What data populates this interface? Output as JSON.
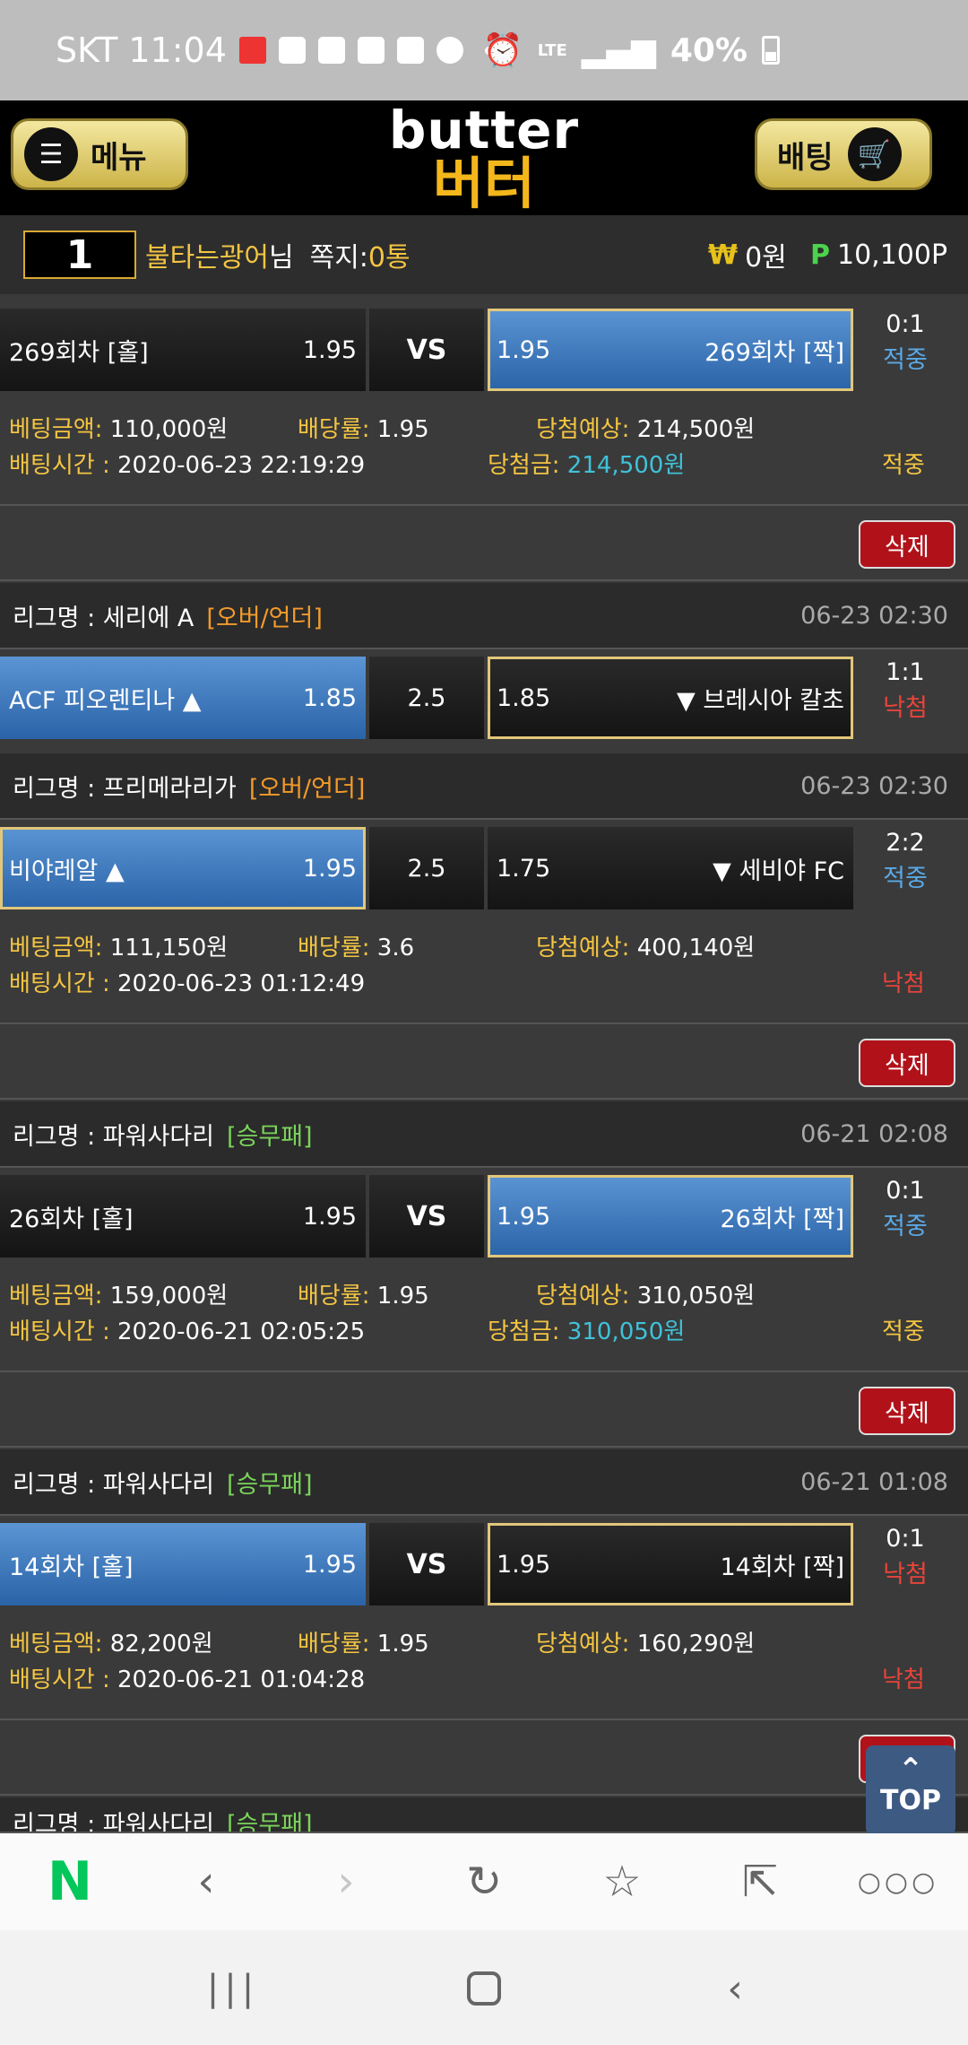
{
  "status_bar": {
    "carrier_time": "SKT 11:04",
    "battery": "40%",
    "lte": "LTE"
  },
  "header": {
    "menu_label": "메뉴",
    "bet_label": "배팅",
    "logo_en": "butter",
    "logo_ko": "버터"
  },
  "user": {
    "rank": "1",
    "name": "불타는광어",
    "suffix": "님",
    "msg_label": "쪽지:",
    "msg_count": "0통",
    "won_symbol": "₩",
    "won": "0원",
    "point_symbol": "P",
    "points": "10,100P"
  },
  "bets": [
    {
      "home_team": "269회차 [홀]",
      "home_odds": "1.95",
      "middle": "VS",
      "away_odds": "1.95",
      "away_team": "269회차 [짝]",
      "score": "0:1",
      "outcome": "적중",
      "amount_label": "베팅금액:",
      "amount": "110,000원",
      "rate_label": "배당률:",
      "rate": "1.95",
      "expected_label": "당첨예상:",
      "expected": "214,500원",
      "time_label": "배팅시간 :",
      "time": "2020-06-23 22:19:29",
      "win_label": "당첨금:",
      "win": "214,500원",
      "status": "적중",
      "delete": "삭제"
    },
    {
      "league_label": "리그명 :",
      "league": "세리에 A",
      "type": "[오버/언더]",
      "date": "06-23 02:30",
      "home_team": "ACF 피오렌티나 ▲",
      "home_odds": "1.85",
      "middle": "2.5",
      "away_odds": "1.85",
      "away_team": "▼ 브레시아 칼초",
      "score": "1:1",
      "outcome": "낙첨"
    },
    {
      "league_label": "리그명 :",
      "league": "프리메라리가",
      "type": "[오버/언더]",
      "date": "06-23 02:30",
      "home_team": "비야레알 ▲",
      "home_odds": "1.95",
      "middle": "2.5",
      "away_odds": "1.75",
      "away_team": "▼ 세비야 FC",
      "score": "2:2",
      "outcome": "적중",
      "amount_label": "베팅금액:",
      "amount": "111,150원",
      "rate_label": "배당률:",
      "rate": "3.6",
      "expected_label": "당첨예상:",
      "expected": "400,140원",
      "time_label": "배팅시간 :",
      "time": "2020-06-23 01:12:49",
      "status": "낙첨",
      "delete": "삭제"
    },
    {
      "league_label": "리그명 :",
      "league": "파워사다리",
      "type": "[승무패]",
      "date": "06-21 02:08",
      "home_team": "26회차 [홀]",
      "home_odds": "1.95",
      "middle": "VS",
      "away_odds": "1.95",
      "away_team": "26회차 [짝]",
      "score": "0:1",
      "outcome": "적중",
      "amount_label": "베팅금액:",
      "amount": "159,000원",
      "rate_label": "배당률:",
      "rate": "1.95",
      "expected_label": "당첨예상:",
      "expected": "310,050원",
      "time_label": "배팅시간 :",
      "time": "2020-06-21 02:05:25",
      "win_label": "당첨금:",
      "win": "310,050원",
      "status": "적중",
      "delete": "삭제"
    },
    {
      "league_label": "리그명 :",
      "league": "파워사다리",
      "type": "[승무패]",
      "date": "06-21 01:08",
      "home_team": "14회차 [홀]",
      "home_odds": "1.95",
      "middle": "VS",
      "away_odds": "1.95",
      "away_team": "14회차 [짝]",
      "score": "0:1",
      "outcome": "낙첨",
      "amount_label": "베팅금액:",
      "amount": "82,200원",
      "rate_label": "배당률:",
      "rate": "1.95",
      "expected_label": "당첨예상:",
      "expected": "160,290원",
      "time_label": "배팅시간 :",
      "time": "2020-06-21 01:04:28",
      "status": "낙첨",
      "delete": "삭제"
    }
  ],
  "partial_league": {
    "league_label": "리그명 :",
    "league": "파워사다리",
    "type": "[승무패]",
    "date": "06-2"
  },
  "top_button": "TOP",
  "browser": {
    "logo": "N"
  }
}
